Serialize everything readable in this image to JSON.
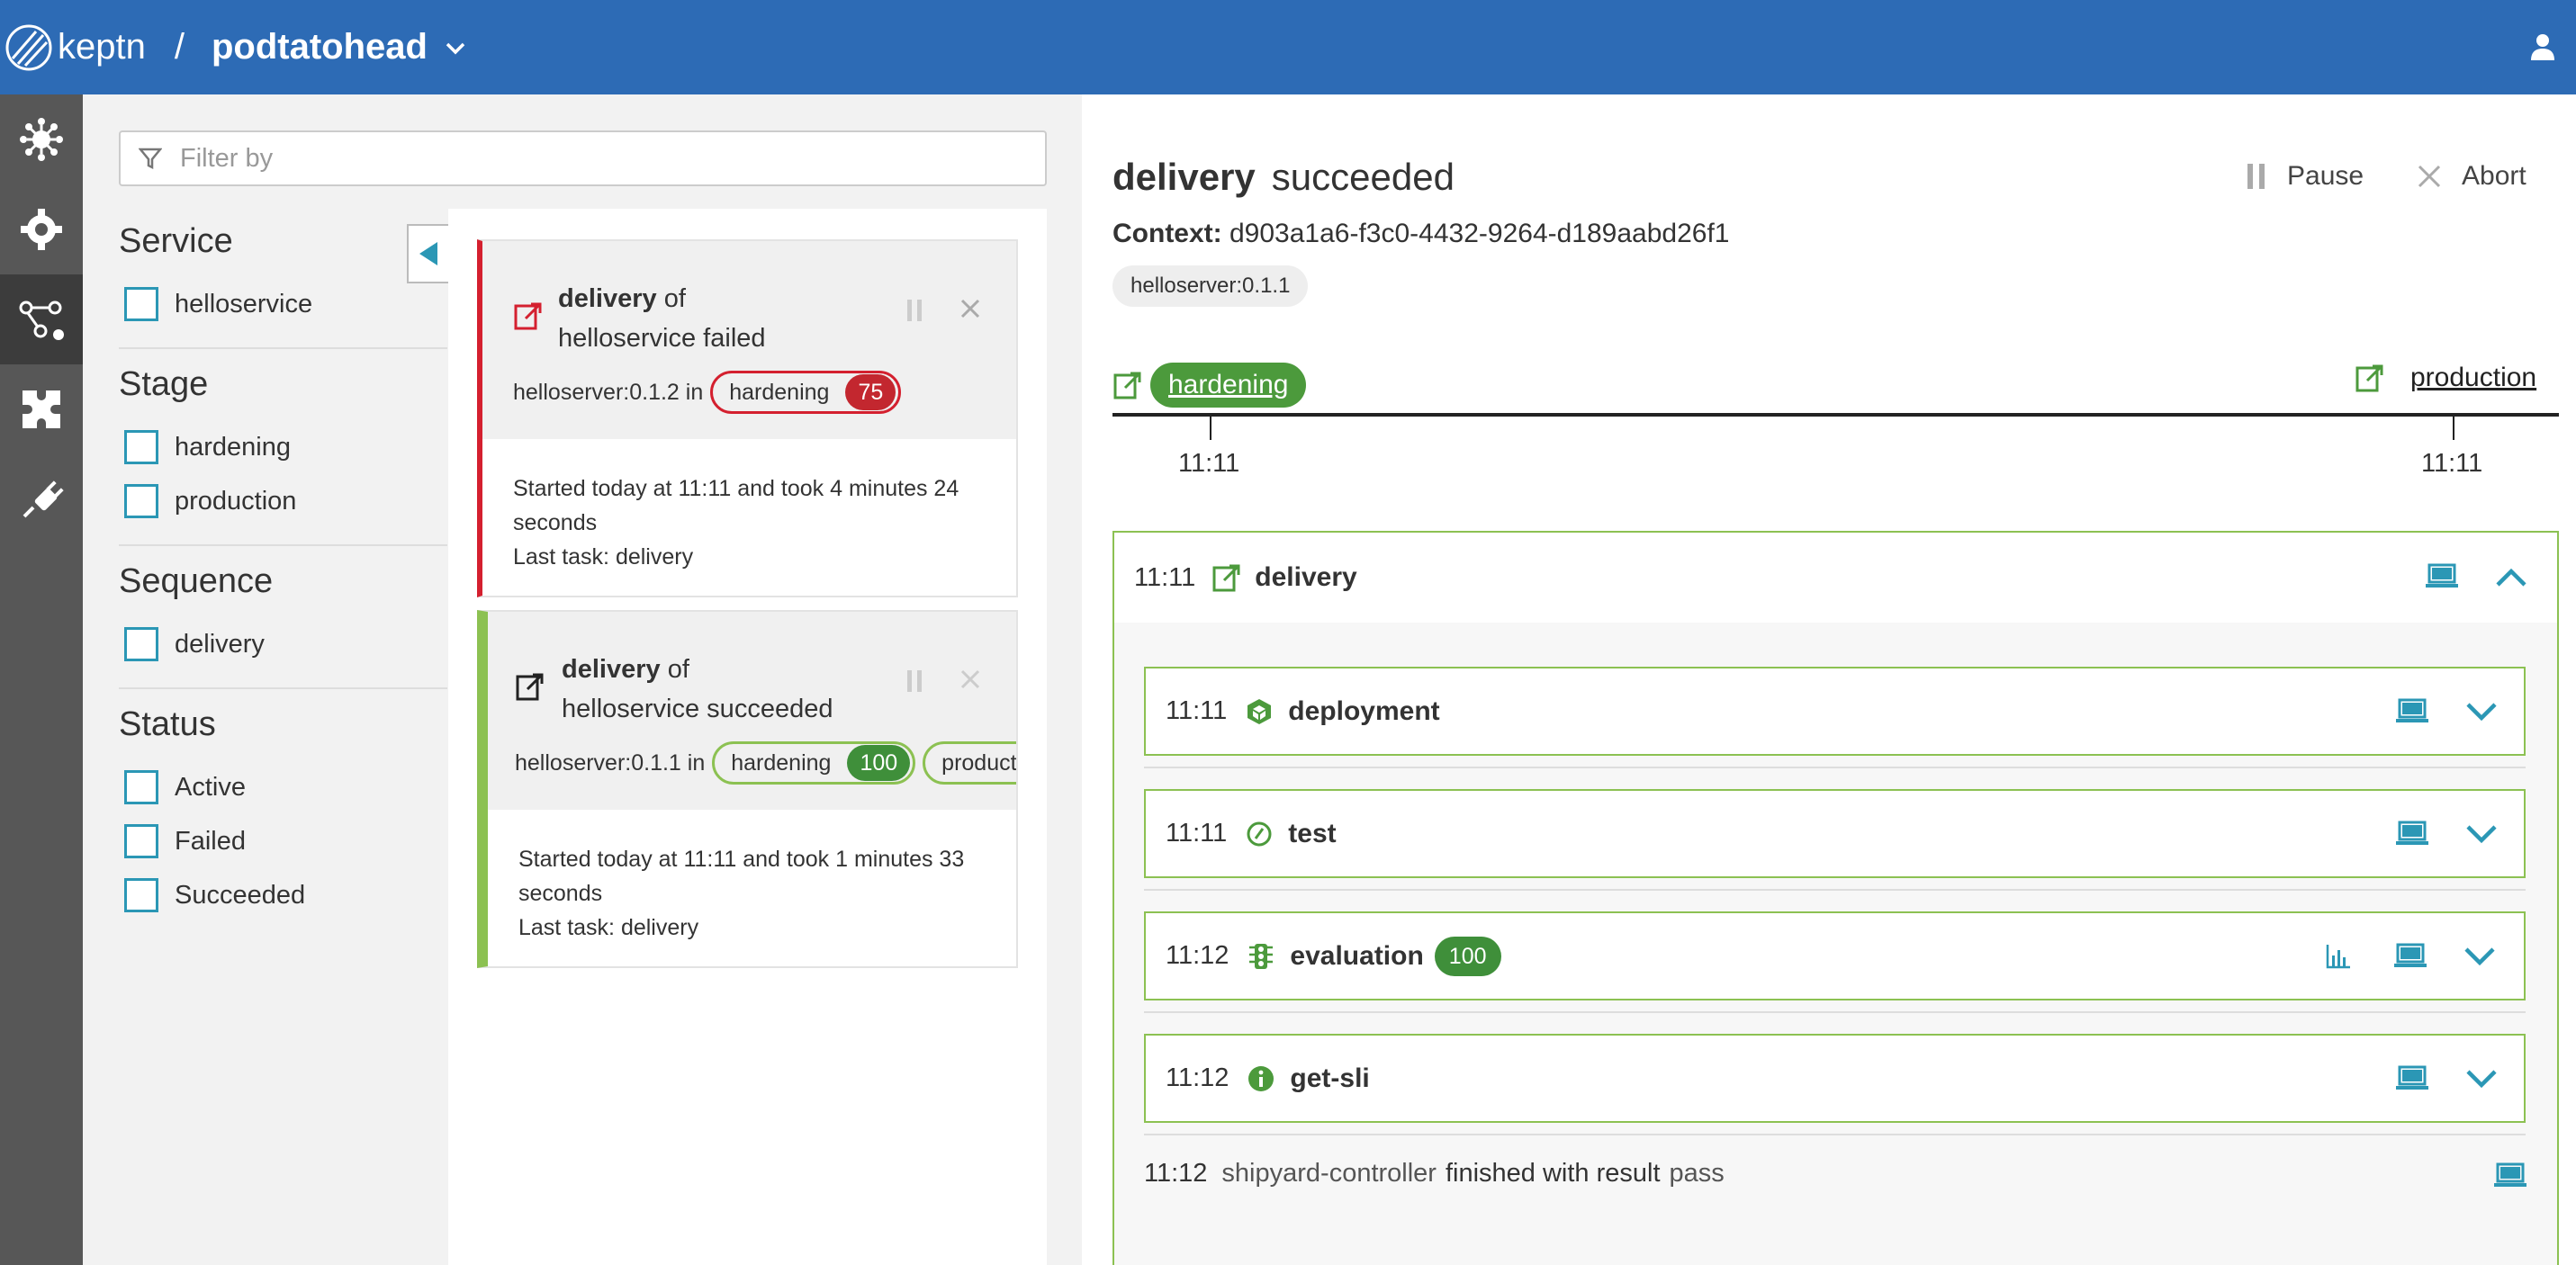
{
  "header": {
    "brand": "keptn",
    "separator": "/",
    "project": "podtatohead"
  },
  "colors": {
    "header_bg": "#2d6bb5",
    "rail_bg": "#575757",
    "accent": "#2b97b5",
    "success": "#8cc152",
    "fail": "#d4202f",
    "score_green": "#3f8f3a",
    "score_red": "#c3272f"
  },
  "rail": {
    "items": [
      {
        "icon": "environment-icon"
      },
      {
        "icon": "settings-gear-icon"
      },
      {
        "icon": "sequences-icon",
        "active": true
      },
      {
        "icon": "services-puzzle-icon"
      },
      {
        "icon": "integrations-plug-icon"
      }
    ]
  },
  "filter": {
    "placeholder": "Filter by",
    "groups": [
      {
        "title": "Service",
        "options": [
          "helloservice"
        ]
      },
      {
        "title": "Stage",
        "options": [
          "hardening",
          "production"
        ]
      },
      {
        "title": "Sequence",
        "options": [
          "delivery"
        ]
      },
      {
        "title": "Status",
        "options": [
          "Active",
          "Failed",
          "Succeeded"
        ]
      }
    ]
  },
  "sequences": [
    {
      "name": "delivery",
      "of": "of",
      "service_line": "helloservice failed",
      "version_line": "helloserver:0.1.2 in",
      "stage": "hardening",
      "score": "75",
      "started": "Started today at 11:11 and took 4 minutes 24 seconds",
      "last_task": "Last task: delivery"
    },
    {
      "name": "delivery",
      "of": "of",
      "service_line": "helloservice succeeded",
      "version_line": "helloserver:0.1.1 in",
      "stage": "hardening",
      "score": "100",
      "stage2": "production",
      "started": "Started today at 11:11 and took 1 minutes 33 seconds",
      "last_task": "Last task: delivery"
    }
  ],
  "detail": {
    "sequence": "delivery",
    "status": "succeeded",
    "pause_label": "Pause",
    "abort_label": "Abort",
    "context_label": "Context:",
    "context_id": "d903a1a6-f3c0-4432-9264-d189aabd26f1",
    "version": "helloserver:0.1.1",
    "timeline": {
      "stages": [
        {
          "name": "hardening",
          "time": "11:11"
        },
        {
          "name": "production",
          "time": "11:11"
        }
      ]
    },
    "sequence_block": {
      "time": "11:11",
      "name": "delivery",
      "tasks": [
        {
          "time": "11:11",
          "name": "deployment",
          "icon": "deployment-icon"
        },
        {
          "time": "11:11",
          "name": "test",
          "icon": "test-gauge-icon"
        },
        {
          "time": "11:12",
          "name": "evaluation",
          "icon": "evaluation-traffic-light-icon",
          "score": "100"
        },
        {
          "time": "11:12",
          "name": "get-sli",
          "icon": "info-icon"
        }
      ],
      "final": {
        "time": "11:12",
        "source": "shipyard-controller",
        "text": "finished with result",
        "result": "pass"
      }
    }
  }
}
